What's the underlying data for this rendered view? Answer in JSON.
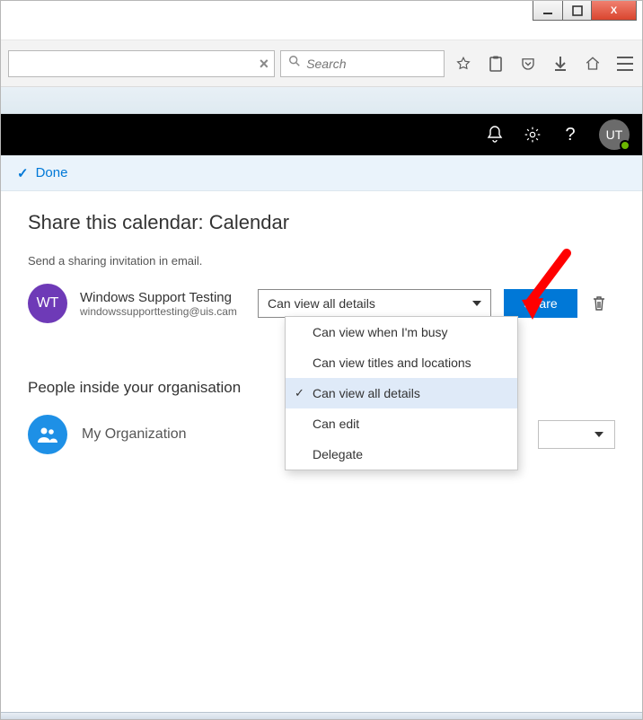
{
  "os": {
    "minimize": "−",
    "maximize": "□",
    "close": "X"
  },
  "browser": {
    "search_placeholder": "Search"
  },
  "appbar": {
    "avatar_initials": "UT"
  },
  "done_bar": {
    "label": "Done"
  },
  "page": {
    "title": "Share this calendar: Calendar",
    "subtitle": "Send a sharing invitation in email."
  },
  "invitee": {
    "initials": "WT",
    "name": "Windows Support Testing",
    "email": "windowssupporttesting@uis.cam"
  },
  "permission": {
    "selected": "Can view all details",
    "options": [
      "Can view when I'm busy",
      "Can view titles and locations",
      "Can view all details",
      "Can edit",
      "Delegate"
    ],
    "selected_index": 2
  },
  "share_button": "Share",
  "org_section": {
    "heading": "People inside your organisation",
    "name": "My Organization"
  }
}
